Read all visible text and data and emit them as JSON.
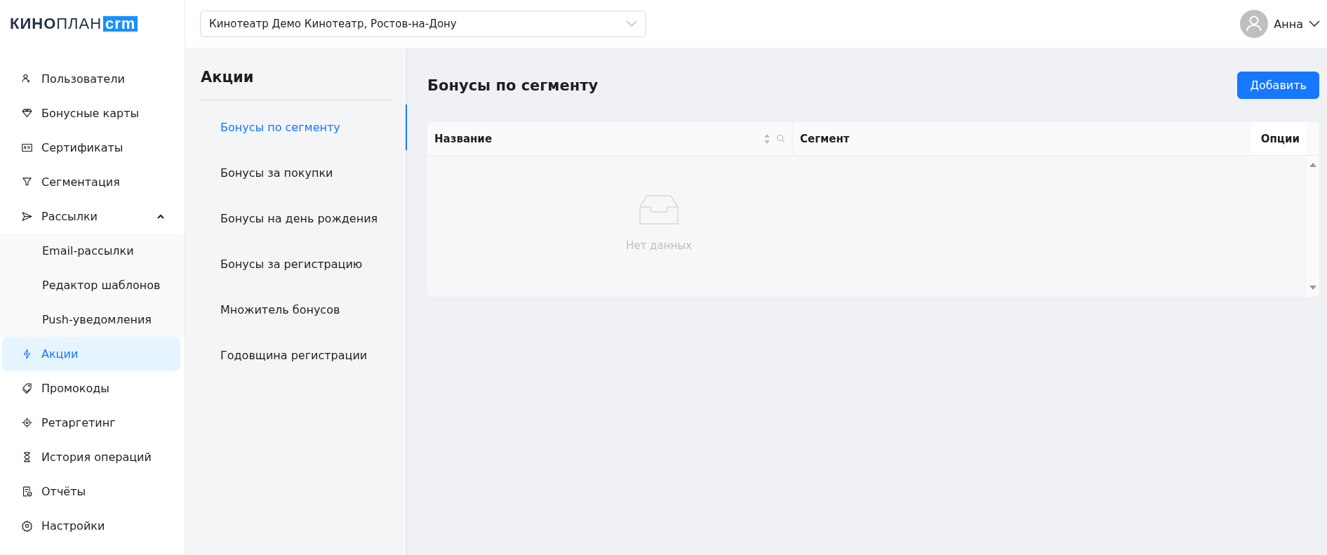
{
  "logo": {
    "bold": "КИНО",
    "light": "ПЛАН",
    "badge": "crm"
  },
  "header": {
    "cinema_select": {
      "value": "Кинотеатр Демо Кинотеатр, Ростов-на-Дону"
    },
    "user": {
      "name": "Анна"
    }
  },
  "sidebar": {
    "items": [
      {
        "label": "Пользователи",
        "selected": false
      },
      {
        "label": "Бонусные карты",
        "selected": false
      },
      {
        "label": "Сертификаты",
        "selected": false
      },
      {
        "label": "Сегментация",
        "selected": false
      },
      {
        "label": "Рассылки",
        "selected": false,
        "expanded": true,
        "children": [
          {
            "label": "Email-рассылки",
            "selected": false
          },
          {
            "label": "Редактор шаблонов",
            "selected": false
          },
          {
            "label": "Push-уведомления",
            "selected": false
          }
        ]
      },
      {
        "label": "Акции",
        "selected": true
      },
      {
        "label": "Промокоды",
        "selected": false
      },
      {
        "label": "Ретаргетинг",
        "selected": false
      },
      {
        "label": "История операций",
        "selected": false
      },
      {
        "label": "Отчёты",
        "selected": false
      },
      {
        "label": "Настройки",
        "selected": false
      }
    ]
  },
  "submenu": {
    "title": "Акции",
    "items": [
      {
        "label": "Бонусы по сегменту",
        "selected": true
      },
      {
        "label": "Бонусы за покупки",
        "selected": false
      },
      {
        "label": "Бонусы на день рождения",
        "selected": false
      },
      {
        "label": "Бонусы за регистрацию",
        "selected": false
      },
      {
        "label": "Множитель бонусов",
        "selected": false
      },
      {
        "label": "Годовщина регистрации",
        "selected": false
      }
    ]
  },
  "main": {
    "title": "Бонусы по сегменту",
    "add_button": "Добавить",
    "table": {
      "columns": [
        "Название",
        "Сегмент",
        "Опции"
      ],
      "empty_text": "Нет данных"
    }
  }
}
